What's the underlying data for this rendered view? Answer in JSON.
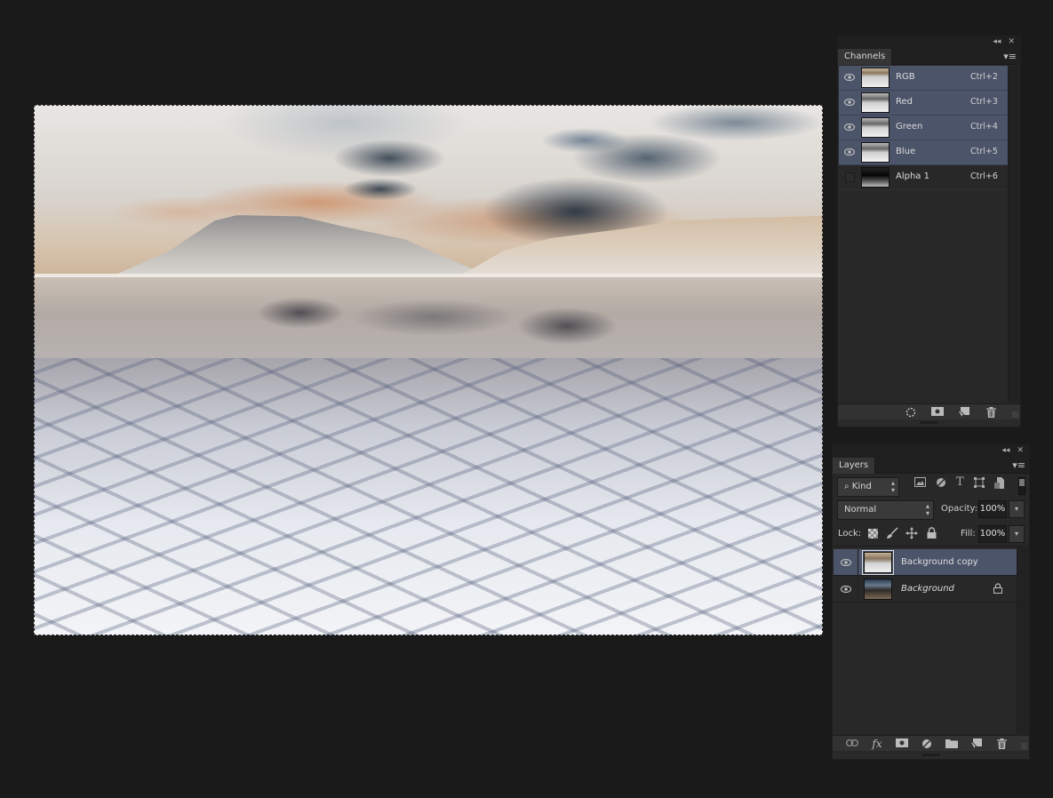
{
  "canvas": {
    "description": "Inverted landscape photo of a volcanic mountain over icy water with active marching-ants selection"
  },
  "channels_panel": {
    "tab_label": "Channels",
    "collapse_icon": "double-chevron-left-icon",
    "close_icon": "close-icon",
    "menu_icon": "panel-menu-icon",
    "channels": [
      {
        "name": "RGB",
        "shortcut": "Ctrl+2",
        "visible": true,
        "selected": true
      },
      {
        "name": "Red",
        "shortcut": "Ctrl+3",
        "visible": true,
        "selected": true
      },
      {
        "name": "Green",
        "shortcut": "Ctrl+4",
        "visible": true,
        "selected": true
      },
      {
        "name": "Blue",
        "shortcut": "Ctrl+5",
        "visible": true,
        "selected": true
      },
      {
        "name": "Alpha 1",
        "shortcut": "Ctrl+6",
        "visible": false,
        "selected": false
      }
    ],
    "footer_buttons": [
      "load-selection-icon",
      "save-selection-icon",
      "new-channel-icon",
      "trash-icon"
    ]
  },
  "layers_panel": {
    "tab_label": "Layers",
    "filter_kind": "Kind",
    "blend_mode": "Normal",
    "opacity_label": "Opacity:",
    "opacity_value": "100%",
    "lock_label": "Lock:",
    "fill_label": "Fill:",
    "fill_value": "100%",
    "layers": [
      {
        "name": "Background copy",
        "visible": true,
        "selected": true,
        "locked": false,
        "italic": false
      },
      {
        "name": "Background",
        "visible": true,
        "selected": false,
        "locked": true,
        "italic": true
      }
    ],
    "footer_buttons": [
      "link-icon",
      "fx-icon",
      "mask-icon",
      "adjustment-icon",
      "folder-icon",
      "new-layer-icon",
      "trash-icon"
    ],
    "fx_label": "fx"
  },
  "colors": {
    "selection_highlight": "#4b5469",
    "panel_bg": "#282828",
    "workspace_bg": "#1a1a1a"
  }
}
